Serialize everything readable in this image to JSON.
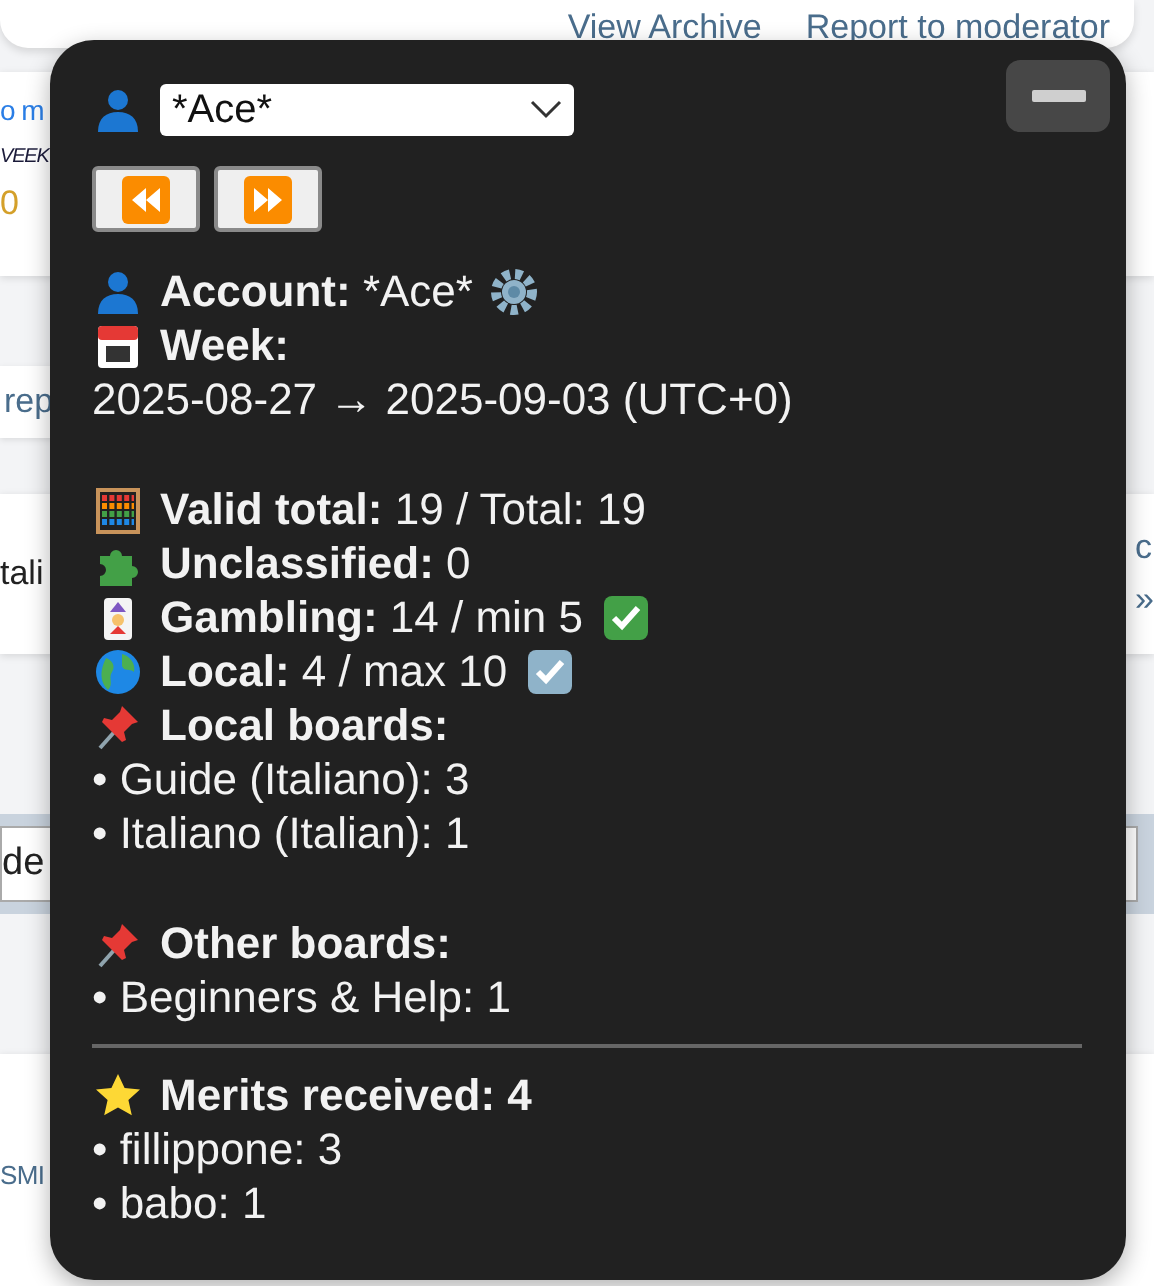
{
  "page": {
    "top_links": [
      "View Archive",
      "Report to moderator"
    ],
    "card_lines": [
      {
        "kind": "link",
        "text": "o m"
      },
      {
        "kind": "italic",
        "text": "VEEK"
      },
      {
        "kind": "count",
        "text": "0"
      }
    ],
    "pill": "rep",
    "row_left": "tali",
    "row_right": [
      "c",
      "»"
    ],
    "field_value": "de",
    "footer_link": "SMI"
  },
  "panel": {
    "account_select": {
      "value": "*Ace*"
    },
    "nav_buttons": [
      {
        "kind": "rewind"
      },
      {
        "kind": "forward"
      }
    ],
    "lines": [
      {
        "kind": "field",
        "label": "Account:",
        "value": " *Ace*"
      },
      {
        "kind": "field",
        "label": "Week:"
      },
      {
        "kind": "text",
        "text": "2025-08-27 → 2025-09-03 (UTC+0)"
      },
      {
        "kind": "blank"
      },
      {
        "kind": "field",
        "label": "Valid total:",
        "value": " 19 / Total: 19"
      },
      {
        "kind": "field",
        "label": "Unclassified:",
        "value": " 0"
      },
      {
        "kind": "field",
        "label": "Gambling:",
        "value": " 14 / min 5"
      },
      {
        "kind": "field",
        "label": "Local:",
        "value": " 4 / max 10"
      },
      {
        "kind": "field",
        "label": "Local boards:"
      },
      {
        "kind": "text",
        "text": "• Guide (Italiano): 3"
      },
      {
        "kind": "text",
        "text": "• Italiano (Italian): 1"
      },
      {
        "kind": "blank"
      },
      {
        "kind": "field",
        "label": "Other boards:"
      },
      {
        "kind": "text",
        "text": "• Beginners & Help: 1"
      },
      {
        "kind": "divider"
      },
      {
        "kind": "field",
        "label": "Merits received: 4"
      },
      {
        "kind": "text",
        "text": "• fillippone: 3"
      },
      {
        "kind": "text",
        "text": "• babo: 1"
      }
    ]
  }
}
